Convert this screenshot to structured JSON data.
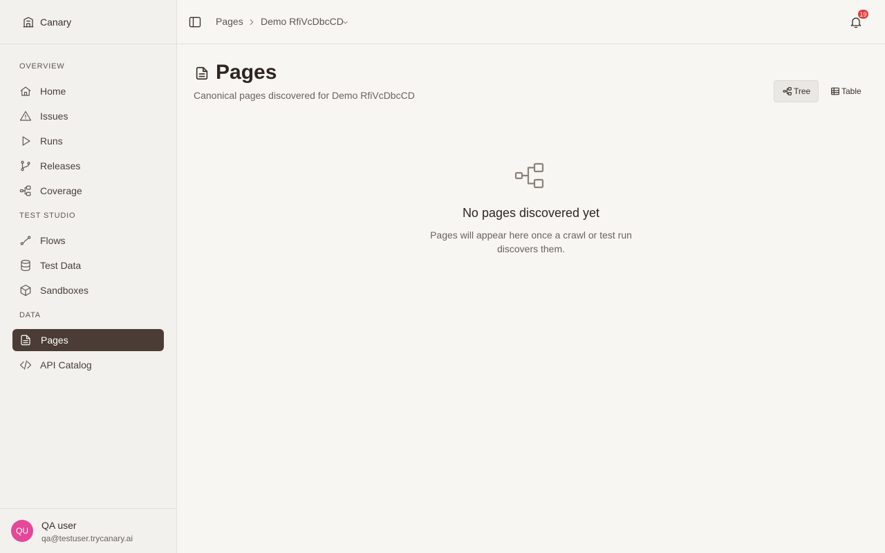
{
  "sidebar": {
    "brand": "Canary",
    "sections": [
      {
        "label": "OVERVIEW"
      },
      {
        "label": "TEST STUDIO"
      },
      {
        "label": "DATA"
      }
    ],
    "items": [
      {
        "label": "Home",
        "icon": "home-icon"
      },
      {
        "label": "Issues",
        "icon": "warning-icon"
      },
      {
        "label": "Runs",
        "icon": "play-icon"
      },
      {
        "label": "Releases",
        "icon": "git-branch-icon"
      },
      {
        "label": "Coverage",
        "icon": "network-icon"
      },
      {
        "label": "Flows",
        "icon": "route-icon"
      },
      {
        "label": "Test Data",
        "icon": "database-icon"
      },
      {
        "label": "Sandboxes",
        "icon": "box-icon"
      },
      {
        "label": "Pages",
        "icon": "file-text-icon",
        "active": true
      },
      {
        "label": "API Catalog",
        "icon": "code-icon"
      }
    ],
    "user": {
      "initials": "QU",
      "name": "QA user",
      "email": "qa@testuser.trycanary.ai"
    }
  },
  "topbar": {
    "breadcrumb": [
      "Pages",
      "Demo RfiVcDbcCD"
    ],
    "notification_count": "19"
  },
  "main": {
    "title": "Pages",
    "subtitle": "Canonical pages discovered for Demo RfiVcDbcCD",
    "views": [
      {
        "label": "Tree",
        "active": true
      },
      {
        "label": "Table",
        "active": false
      }
    ],
    "empty_state": {
      "title": "No pages discovered yet",
      "text": "Pages will appear here once a crawl or test run discovers them."
    }
  },
  "colors": {
    "background": "#f7f6f3",
    "sidebar": "#f2f1ee",
    "active_nav": "#4b3d36",
    "avatar": "#e3489a",
    "badge": "#e23b3b"
  }
}
